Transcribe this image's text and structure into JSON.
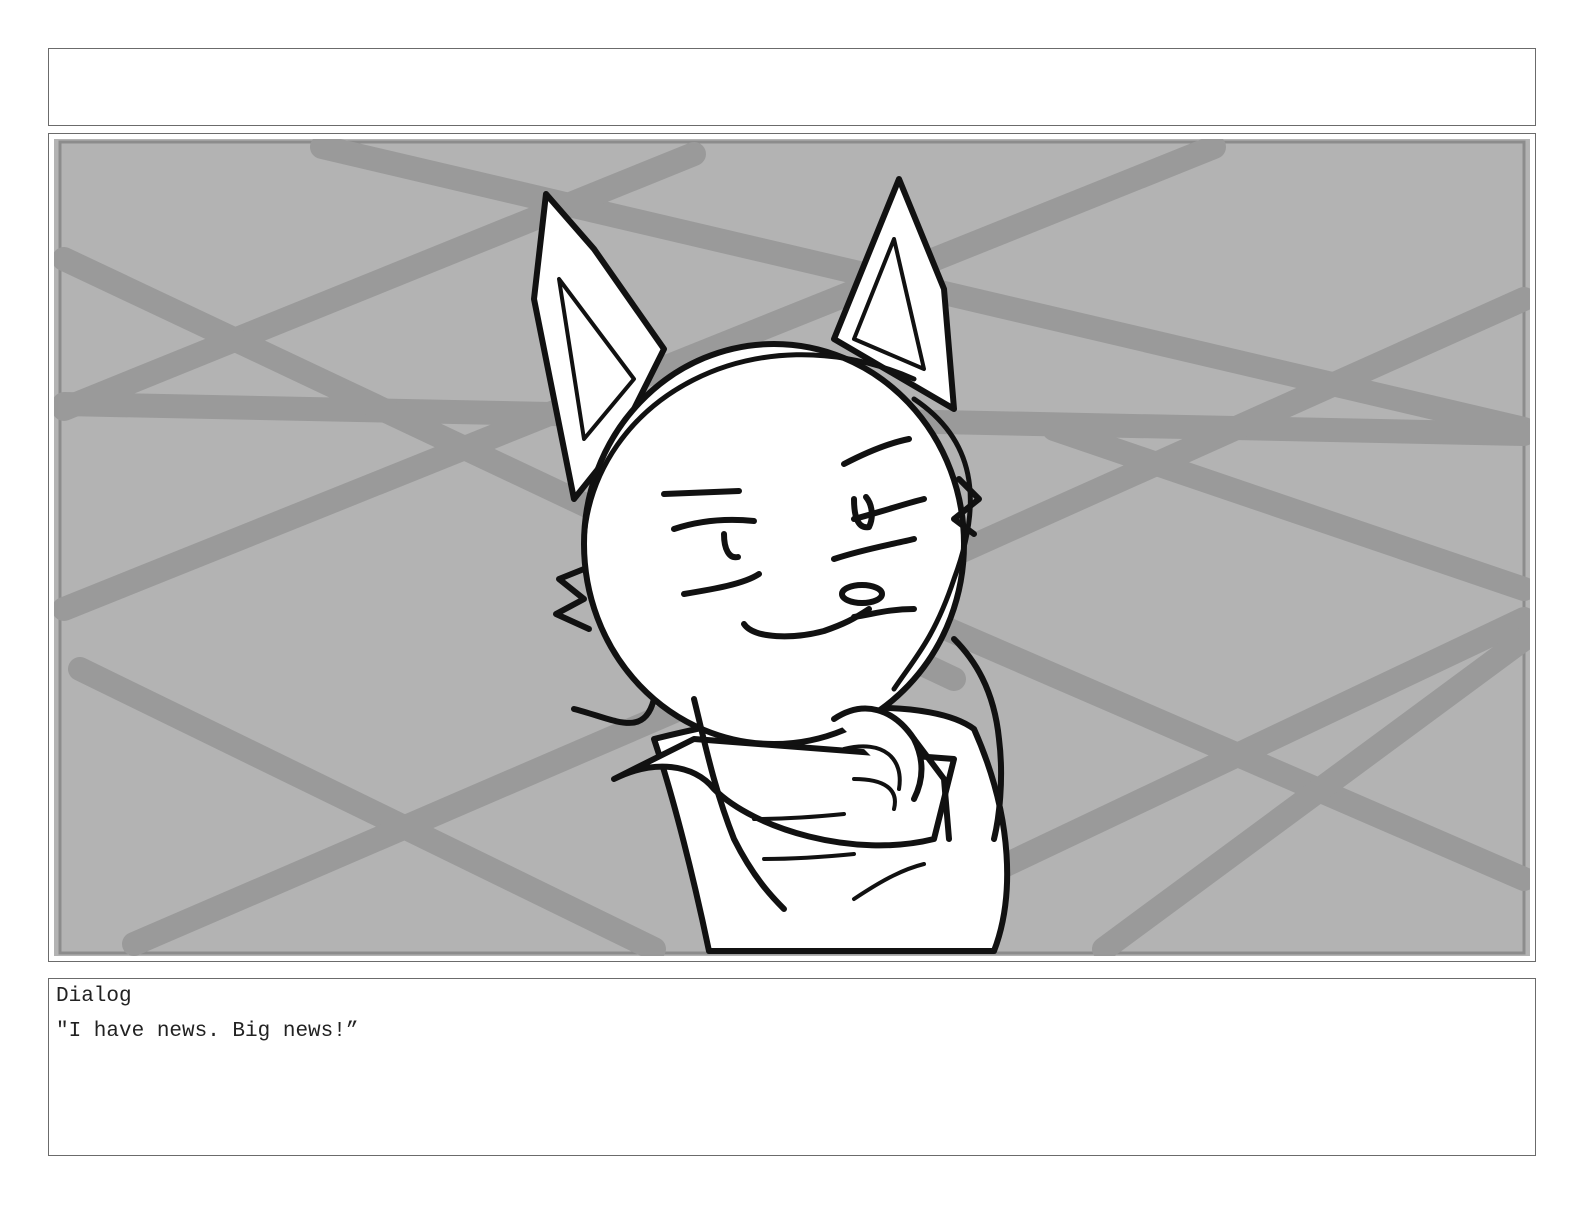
{
  "dialog": {
    "label": "Dialog",
    "text": "\"I have news. Big news!”"
  },
  "panel": {
    "subject_icon": "cat-character-illustration",
    "colors": {
      "background": "#b3b3b3",
      "floor_lines": "#9a9a9a",
      "ink": "#111111",
      "character_fill": "#ffffff",
      "frame": "#6b6b6b"
    }
  }
}
